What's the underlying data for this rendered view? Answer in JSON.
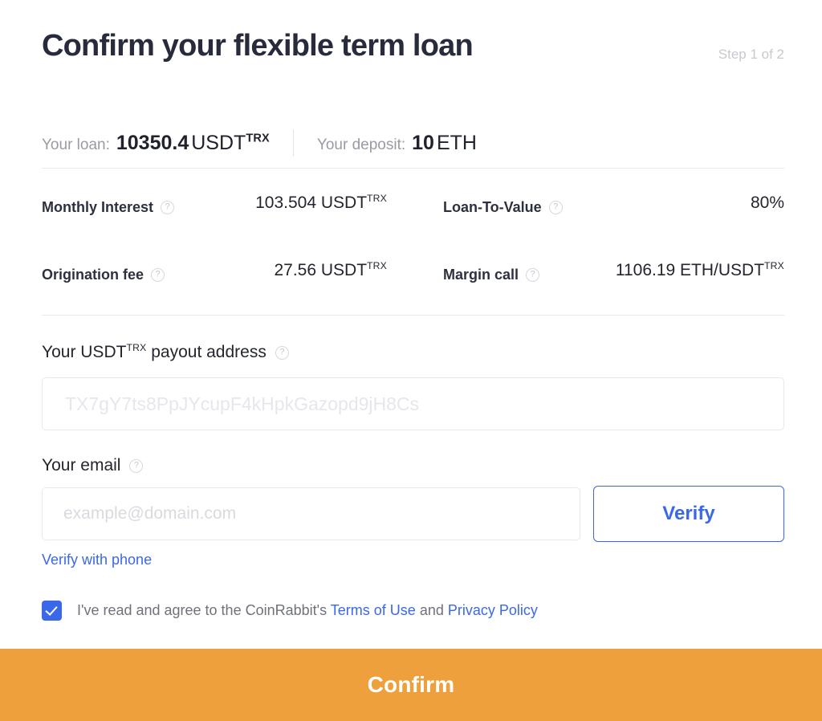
{
  "header": {
    "title": "Confirm your flexible term loan",
    "step": "Step 1 of 2"
  },
  "summary": {
    "loan_label": "Your loan:",
    "loan_amount": "10350.4",
    "loan_currency": "USDT",
    "loan_currency_network": "TRX",
    "deposit_label": "Your deposit:",
    "deposit_amount": "10",
    "deposit_currency": "ETH"
  },
  "stats": [
    {
      "label": "Monthly Interest",
      "value": "103.504 USDT",
      "value_network": "TRX",
      "help_icon": "question-mark-circle-icon"
    },
    {
      "label": "Loan-To-Value",
      "value": "80%",
      "value_network": "",
      "help_icon": "question-mark-circle-icon"
    },
    {
      "label": "Origination fee",
      "value": "27.56 USDT",
      "value_network": "TRX",
      "help_icon": "question-mark-circle-icon"
    },
    {
      "label": "Margin call",
      "value": "1106.19 ETH/USDT",
      "value_network": "TRX",
      "help_icon": "question-mark-circle-icon"
    }
  ],
  "payout": {
    "label_prefix": "Your USDT",
    "label_network": "TRX",
    "label_suffix": " payout address",
    "value": "",
    "placeholder": "TX7gY7ts8PpJYcupF4kHpkGazopd9jH8Cs"
  },
  "email": {
    "label": "Your email",
    "value": "",
    "placeholder": "example@domain.com",
    "verify_label": "Verify",
    "phone_link_label": "Verify with phone"
  },
  "terms": {
    "checked": true,
    "text_before": "I've read and agree to the CoinRabbit's",
    "terms_link": "Terms of Use",
    "text_between": "and",
    "privacy_link": "Privacy Policy"
  },
  "footer": {
    "confirm_label": "Confirm"
  },
  "colors": {
    "accent_blue": "#3a68e8",
    "confirm_orange": "#eda03c",
    "title_dark": "#282b3c",
    "muted_gray": "#9a9ba3"
  }
}
